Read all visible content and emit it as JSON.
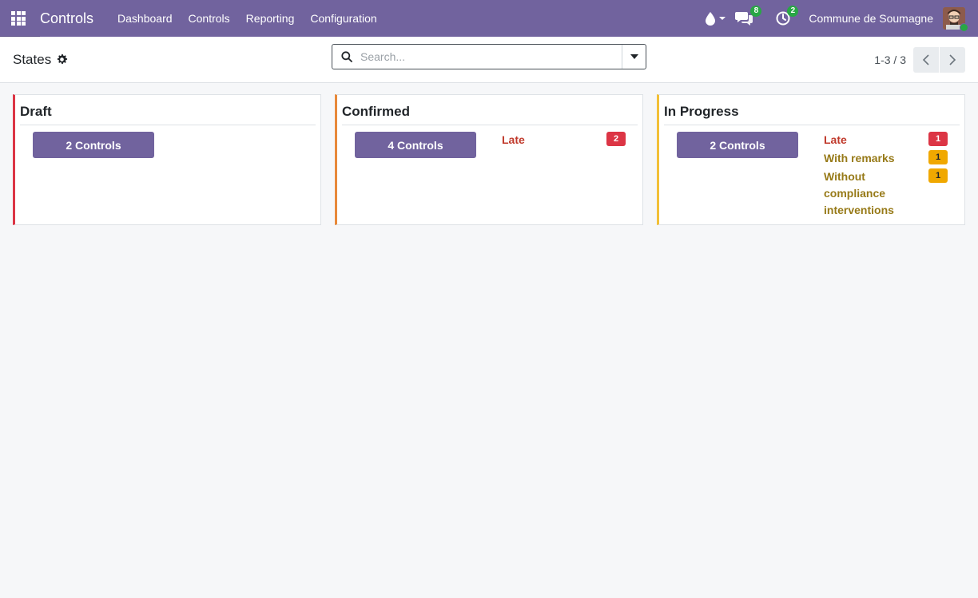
{
  "navbar": {
    "app_title": "Controls",
    "menu": [
      "Dashboard",
      "Controls",
      "Reporting",
      "Configuration"
    ],
    "messages_count": "8",
    "activities_count": "2",
    "company": "Commune de Soumagne"
  },
  "control_panel": {
    "title": "States",
    "search_placeholder": "Search...",
    "pager": "1-3 / 3"
  },
  "columns": [
    {
      "title": "Draft",
      "button": "2 Controls",
      "stats": []
    },
    {
      "title": "Confirmed",
      "button": "4 Controls",
      "stats": [
        {
          "label": "Late",
          "count": "2"
        }
      ]
    },
    {
      "title": "In Progress",
      "button": "2 Controls",
      "stats": [
        {
          "label": "Late",
          "count": "1"
        },
        {
          "label": "With remarks",
          "count": "1"
        },
        {
          "label": "Without compliance interventions",
          "count": "1"
        }
      ]
    }
  ],
  "colors": {
    "brand": "#71639e",
    "draft": "#dc3545",
    "confirmed": "#e8893a",
    "in_progress": "#f2c037",
    "badge_red": "#dc3545",
    "badge_amber": "#f0a800"
  }
}
